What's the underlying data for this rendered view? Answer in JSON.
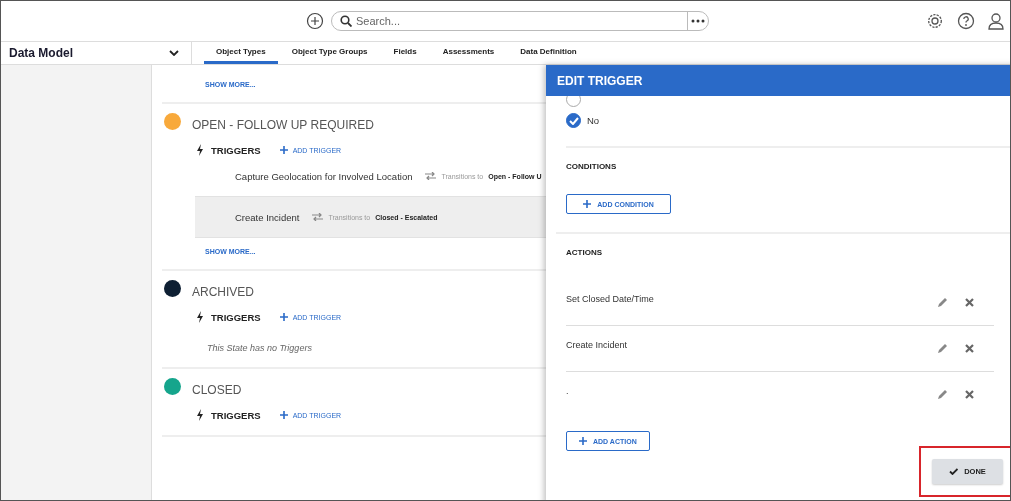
{
  "topbar": {
    "search_placeholder": "Search..."
  },
  "nav": {
    "title": "Data Model",
    "tabs": [
      {
        "label": "Object Types",
        "selected": true
      },
      {
        "label": "Object Type Groups",
        "selected": false
      },
      {
        "label": "Fields",
        "selected": false
      },
      {
        "label": "Assessments",
        "selected": false
      },
      {
        "label": "Data Definition",
        "selected": false
      }
    ]
  },
  "states": [
    {
      "show_more": "SHOW MORE..."
    },
    {
      "title": "OPEN - FOLLOW UP REQUIRED",
      "color": "#f8a93b",
      "triggers_label": "TRIGGERS",
      "add_trigger": "ADD TRIGGER",
      "triggers": [
        {
          "name": "Capture Geolocation for Involved Location",
          "transition_label": "Transitions to",
          "target": "Open - Follow U",
          "selected": false
        },
        {
          "name": "Create Incident",
          "transition_label": "Transitions to",
          "target": "Closed - Escalated",
          "selected": true
        }
      ],
      "show_more": "SHOW MORE..."
    },
    {
      "title": "ARCHIVED",
      "color": "#0e1f33",
      "triggers_label": "TRIGGERS",
      "add_trigger": "ADD TRIGGER",
      "empty": "This State has no Triggers"
    },
    {
      "title": "CLOSED",
      "color": "#15a58c",
      "triggers_label": "TRIGGERS",
      "add_trigger": "ADD TRIGGER"
    }
  ],
  "panel": {
    "title": "EDIT TRIGGER",
    "options": [
      {
        "selected": false
      },
      {
        "label": "No",
        "selected": true
      }
    ],
    "conditions": {
      "heading": "CONDITIONS",
      "add": "ADD CONDITION"
    },
    "actions": {
      "heading": "ACTIONS",
      "items": [
        "Set Closed Date/Time",
        "Create Incident",
        "."
      ],
      "add": "ADD ACTION"
    },
    "done": {
      "label": "DONE",
      "highlighted": true
    }
  }
}
